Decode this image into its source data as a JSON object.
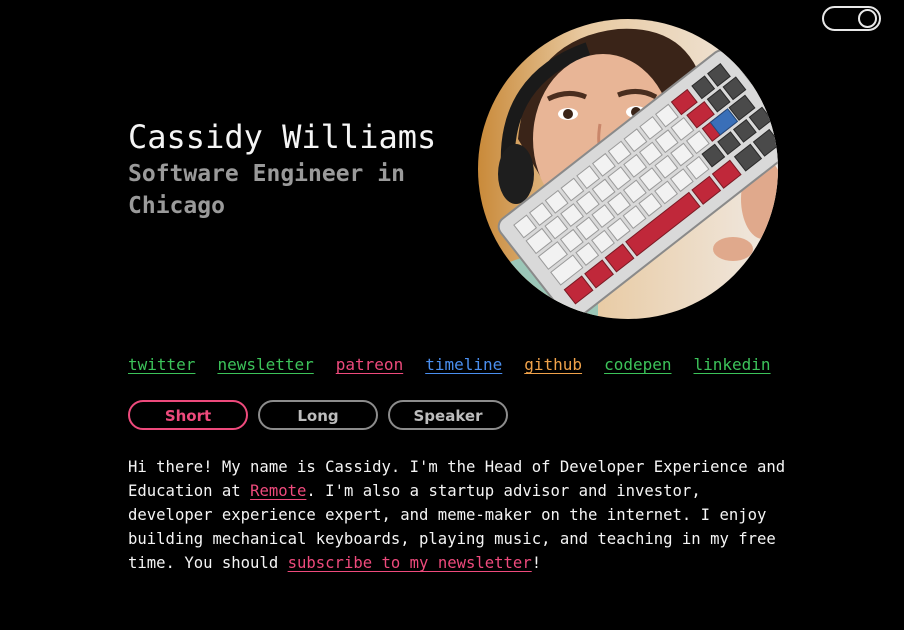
{
  "header": {
    "name": "Cassidy Williams",
    "subtitle": "Software Engineer in Chicago"
  },
  "avatar": {
    "alt": "Cassidy holding a mechanical keyboard"
  },
  "social": [
    {
      "label": "twitter",
      "color": "#3cc35a"
    },
    {
      "label": "newsletter",
      "color": "#3cc35a"
    },
    {
      "label": "patreon",
      "color": "#ee4a7c"
    },
    {
      "label": "timeline",
      "color": "#4a8ff0"
    },
    {
      "label": "github",
      "color": "#f0a24a"
    },
    {
      "label": "codepen",
      "color": "#3cc35a"
    },
    {
      "label": "linkedin",
      "color": "#3cc35a"
    }
  ],
  "bio_tabs": {
    "short": "Short",
    "long": "Long",
    "speaker": "Speaker",
    "selected": "Short"
  },
  "bio": {
    "part1": "Hi there! My name is Cassidy. I'm the Head of Developer Experience and Education at ",
    "remote_link": "Remote",
    "part2": ". I'm also a startup advisor and investor, developer experience expert, and meme-maker on the internet. I enjoy building mechanical keyboards, playing music, and teaching in my free time. You should ",
    "newsletter_link": "subscribe to my newsletter",
    "part3": "!"
  },
  "theme": {
    "accent": "#ee4a7c",
    "background": "#000000",
    "toggle_state": "dark"
  }
}
